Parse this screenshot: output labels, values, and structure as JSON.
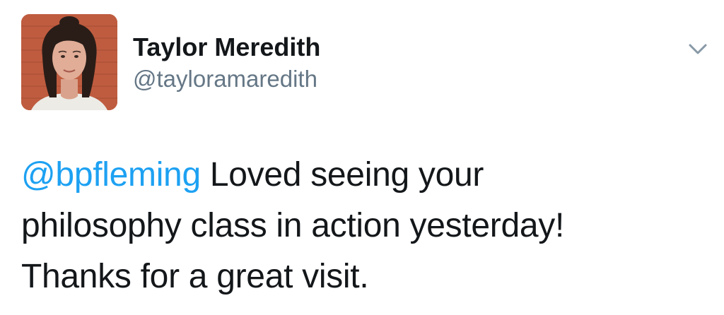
{
  "author": {
    "display_name": "Taylor Meredith",
    "handle": "@tayloramaredith"
  },
  "menu": {
    "icon": "chevron-down-icon"
  },
  "tweet": {
    "mention": "@bpfleming",
    "line1_rest": " Loved seeing your",
    "line2": "philosophy class in action yesterday!",
    "line3": "Thanks for a great visit."
  },
  "colors": {
    "mention": "#1da1f2",
    "text": "#14171a",
    "handle": "#657786",
    "chevron": "#8899a6"
  }
}
